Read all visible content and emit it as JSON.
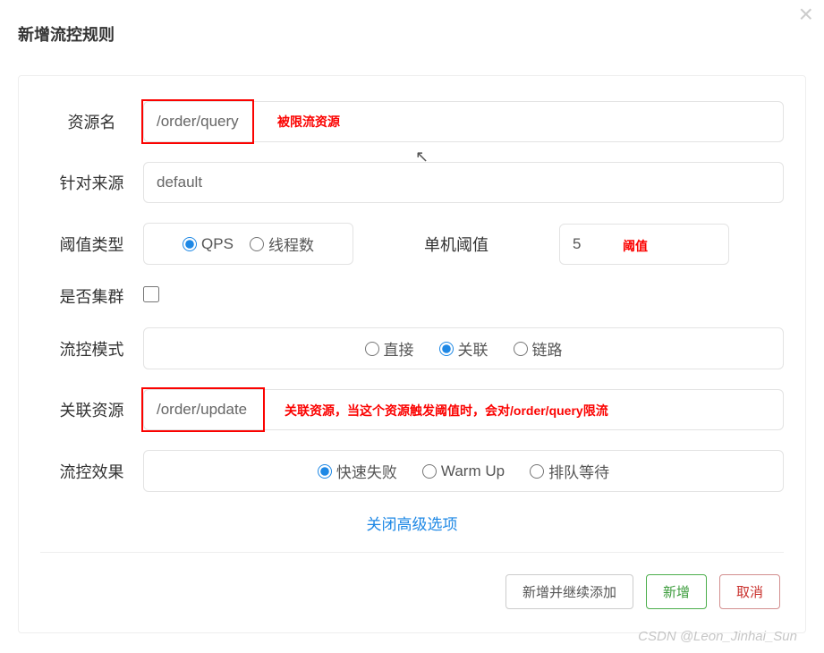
{
  "modal": {
    "title": "新增流控规则",
    "close_label": "×"
  },
  "fields": {
    "resource": {
      "label": "资源名",
      "value": "/order/query",
      "annotation": "被限流资源"
    },
    "source": {
      "label": "针对来源",
      "value": "default"
    },
    "threshold_type": {
      "label": "阈值类型",
      "options": {
        "qps": "QPS",
        "thread": "线程数"
      },
      "selected": "qps",
      "single_label": "单机阈值",
      "single_value": "5",
      "annotation": "阈值"
    },
    "cluster": {
      "label": "是否集群",
      "checked": false
    },
    "mode": {
      "label": "流控模式",
      "options": {
        "direct": "直接",
        "relation": "关联",
        "chain": "链路"
      },
      "selected": "relation"
    },
    "related": {
      "label": "关联资源",
      "value": "/order/update",
      "annotation": "关联资源，当这个资源触发阈值时，会对/order/query限流"
    },
    "effect": {
      "label": "流控效果",
      "options": {
        "fast": "快速失败",
        "warmup": "Warm Up",
        "queue": "排队等待"
      },
      "selected": "fast"
    }
  },
  "collapse_link": "关闭高级选项",
  "footer": {
    "add_continue": "新增并继续添加",
    "add": "新增",
    "cancel": "取消"
  },
  "watermark": "CSDN @Leon_Jinhai_Sun"
}
